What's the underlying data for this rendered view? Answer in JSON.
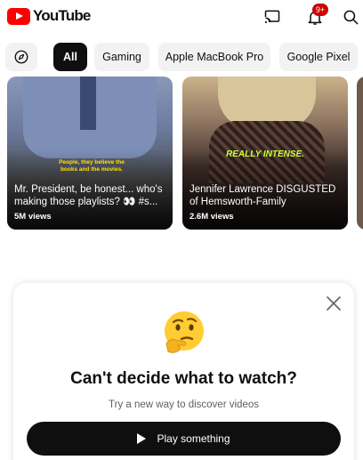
{
  "app": {
    "name": "YouTube"
  },
  "header": {
    "notification_count": "9+",
    "icons": [
      "cast-icon",
      "bell-icon",
      "search-icon"
    ]
  },
  "chips": {
    "explore_icon": "compass-icon",
    "items": [
      {
        "label": "All",
        "active": true
      },
      {
        "label": "Gaming",
        "active": false
      },
      {
        "label": "Apple MacBook Pro",
        "active": false
      },
      {
        "label": "Google Pixel",
        "active": false
      }
    ]
  },
  "videos": [
    {
      "caption": "People, they believe the books and the movies.",
      "title": "Mr. President, be honest... who's making those playlists? 👀 #s...",
      "views": "5M views"
    },
    {
      "caption": "REALLY INTENSE.",
      "title": "Jennifer Lawrence DISGUSTED of Hemsworth-Family",
      "views": "2.6M views"
    }
  ],
  "prompt": {
    "title": "Can't decide what to watch?",
    "subtitle": "Try a new way to discover videos",
    "button_label": "Play something",
    "emoji": "thinking-face"
  },
  "colors": {
    "brand": "#ff0000",
    "badge": "#cc0000",
    "active_chip": "#0f0f0f",
    "chip_bg": "#f2f2f2"
  }
}
